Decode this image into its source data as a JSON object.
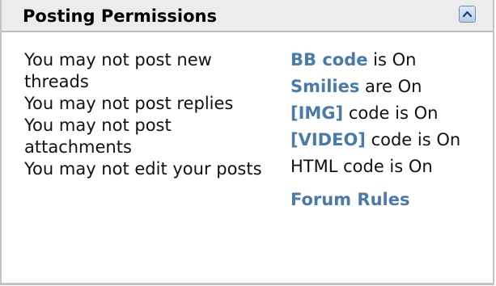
{
  "header": {
    "title": "Posting Permissions",
    "collapse_icon": "chevron-up-icon"
  },
  "permissions": [
    "You may not post new threads",
    "You may not post replies",
    "You may not post attachments",
    "You may not edit your posts"
  ],
  "settings": {
    "bbcode_link": "BB code",
    "bbcode_text": " is On",
    "smilies_link": "Smilies",
    "smilies_text": " are On",
    "img_link": "[IMG]",
    "img_text": " code is On",
    "video_link": "[VIDEO]",
    "video_text": " code is On",
    "html_text": "HTML code is On",
    "forum_rules": "Forum Rules"
  },
  "colors": {
    "link": "#4a7aa8",
    "header_bg": "#ececec",
    "border": "#c4c4c4"
  }
}
